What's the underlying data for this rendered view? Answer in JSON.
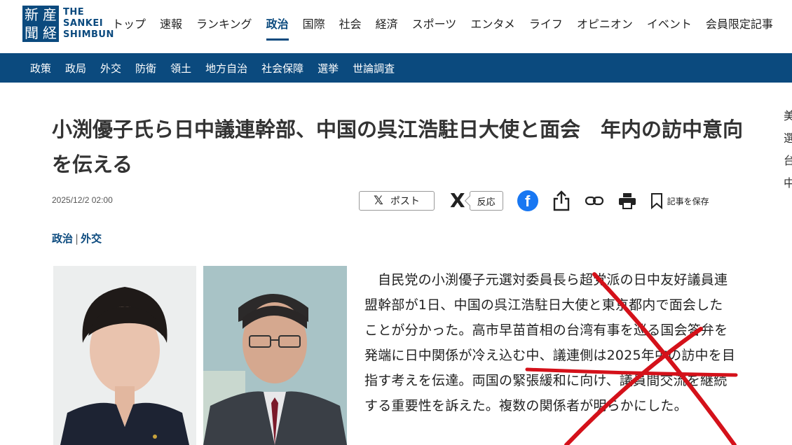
{
  "brand": {
    "logo_kanji": [
      "新",
      "産",
      "聞",
      "経"
    ],
    "logo_text": [
      "THE",
      "SANKEI",
      "SHIMBUN"
    ]
  },
  "top_nav": [
    {
      "label": "トップ",
      "active": false
    },
    {
      "label": "速報",
      "active": false
    },
    {
      "label": "ランキング",
      "active": false
    },
    {
      "label": "政治",
      "active": true
    },
    {
      "label": "国際",
      "active": false
    },
    {
      "label": "社会",
      "active": false
    },
    {
      "label": "経済",
      "active": false
    },
    {
      "label": "スポーツ",
      "active": false
    },
    {
      "label": "エンタメ",
      "active": false
    },
    {
      "label": "ライフ",
      "active": false
    },
    {
      "label": "オピニオン",
      "active": false
    },
    {
      "label": "イベント",
      "active": false
    },
    {
      "label": "会員限定記事",
      "active": false
    }
  ],
  "sub_nav": [
    "政策",
    "政局",
    "外交",
    "防衛",
    "領土",
    "地方自治",
    "社会保障",
    "選挙",
    "世論調査"
  ],
  "article": {
    "headline": "小渕優子氏ら日中議連幹部、中国の呉江浩駐日大使と面会　年内の訪中意向を伝える",
    "date": "2025/12/2 02:00",
    "categories": [
      "政治",
      "外交"
    ],
    "category_separator": "|",
    "body": "自民党の小渕優子元選対委員長ら超党派の日中友好議員連盟幹部が1日、中国の呉江浩駐日大使と東京都内で面会したことが分かった。高市早苗首相の台湾有事を巡る国会答弁を発端に日中関係が冷え込む中、議連側は2025年中の訪中を目指す考えを伝達。両国の緊張緩和に向け、議員間交流を継続する重要性を訴えた。複数の関係者が明らかにした。"
  },
  "share": {
    "post_label": "ポスト",
    "x_glyph": "𝕏",
    "x_big_glyph": "X",
    "react_label": "反応",
    "fb_glyph": "f",
    "save_label": "記事を保存"
  },
  "right_edge_chars": [
    "美",
    "選",
    "台",
    "中"
  ],
  "icons": [
    "x-icon",
    "facebook-icon",
    "share-icon",
    "link-icon",
    "print-icon",
    "bookmark-icon"
  ],
  "colors": {
    "brand_blue": "#0b4a7e",
    "facebook_blue": "#1877f2",
    "annotation_red": "#d4111a"
  }
}
